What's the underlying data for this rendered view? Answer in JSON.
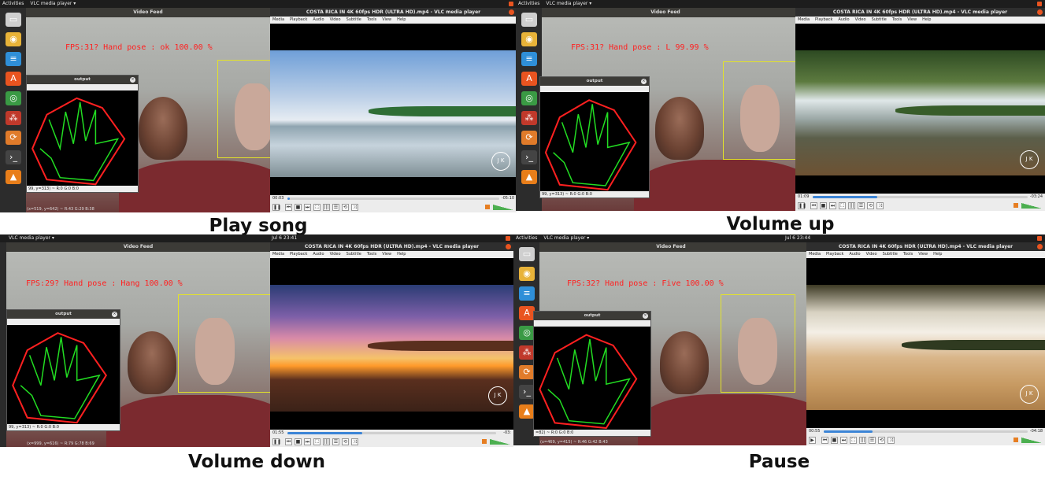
{
  "panels": [
    {
      "id": "play",
      "caption": "Play song",
      "topbar": {
        "activities": "Activities",
        "app": "VLC media player ▾",
        "clock": ""
      },
      "feed_title": "Video Feed",
      "fps_text": "FPS:31? Hand pose : ok 100.00 %",
      "output_title": "output",
      "output_status": "99, y=313) ~ R:0 G:0 B:0",
      "bottom_status": "(x=519, y=642) ~ R:43 G:29 B:38",
      "vlc_title": "COSTA RICA IN 4K 60fps HDR (ULTRA HD).mp4 - VLC media player",
      "time_elapsed": "00:03",
      "time_remaining": "-05:10",
      "seek_progress": 0.01,
      "scene": "beach"
    },
    {
      "id": "volup",
      "caption": "Volume up",
      "topbar": {
        "activities": "Activities",
        "app": "VLC media player ▾",
        "clock": ""
      },
      "feed_title": "Video Feed",
      "fps_text": "FPS:31? Hand pose : L 99.99 %",
      "output_title": "output",
      "output_status": "99, y=313) ~ R:0 G:0 B:0",
      "bottom_status": "",
      "vlc_title": "COSTA RICA IN 4K 60fps HDR (ULTRA HD).mp4 - VLC media player",
      "time_elapsed": "01:09",
      "time_remaining": "-03:24",
      "seek_progress": 0.3,
      "scene": "waterfall"
    },
    {
      "id": "voldown",
      "caption": "Volume down",
      "topbar": {
        "activities": "",
        "app": "VLC media player ▾",
        "clock": "Jul 6  23:41"
      },
      "feed_title": "Video Feed",
      "fps_text": "FPS:29? Hand pose : Hang 100.00 %",
      "output_title": "output",
      "output_status": "99, y=313) ~ R:0 G:0 B:0",
      "bottom_status": "(x=999, y=616) ~ R:79 G:78 B:69",
      "vlc_title": "COSTA RICA IN 4K 60fps HDR (ULTRA HD).mp4 - VLC media player",
      "time_elapsed": "01:55",
      "time_remaining": "-03:",
      "seek_progress": 0.36,
      "scene": "sunset"
    },
    {
      "id": "pause",
      "caption": "Pause",
      "topbar": {
        "activities": "Activities",
        "app": "VLC media player ▾",
        "clock": "Jul 6  23:44"
      },
      "feed_title": "Video Feed",
      "fps_text": "FPS:32? Hand pose : Five 100.00 %",
      "output_title": "output",
      "output_status": "=82) ~ R:0 G:0 B:0",
      "bottom_status": "(x=469, y=415) ~ R:46 G:42 B:43",
      "vlc_title": "COSTA RICA IN 4K 60fps HDR (ULTRA HD).mp4 - VLC media player",
      "time_elapsed": "00:55",
      "time_remaining": "-04:18",
      "seek_progress": 0.24,
      "scene": "sand"
    }
  ],
  "vlc_menu": [
    "Media",
    "Playback",
    "Audio",
    "Video",
    "Subtitle",
    "Tools",
    "View",
    "Help"
  ],
  "watermark_text": "J K",
  "colors": {
    "fps_text": "#ff2020",
    "roi_box": "#e2e22a",
    "hull": "#ff2020",
    "contour": "#22dd22",
    "seek_fill": "#3b84d6"
  }
}
